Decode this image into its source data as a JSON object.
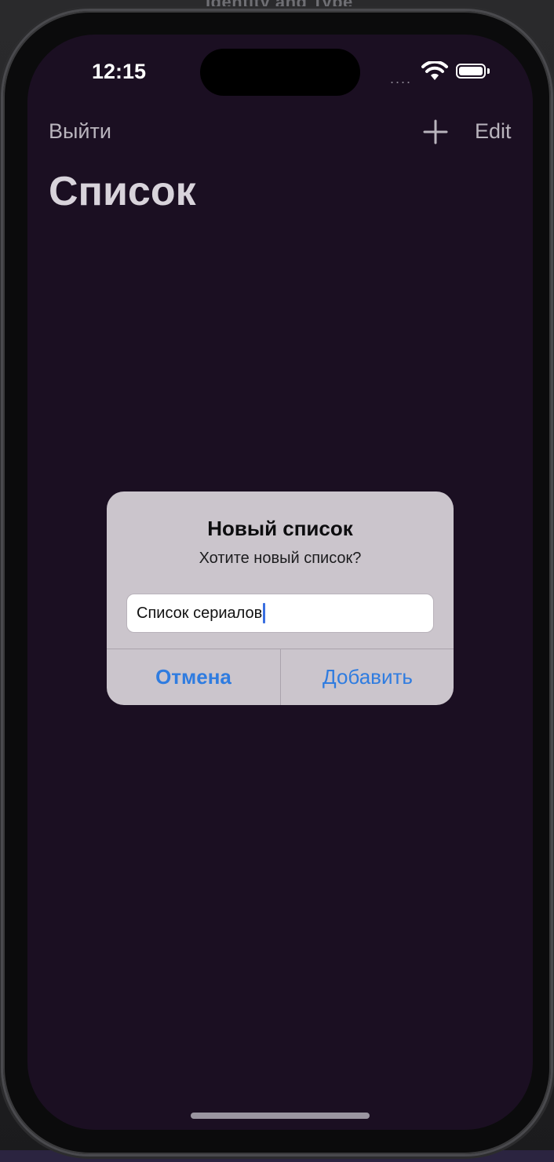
{
  "backdrop": {
    "header_text": "Identity and Type"
  },
  "status_bar": {
    "time": "12:15",
    "signal": "....",
    "wifi_icon": "wifi-icon",
    "battery_icon": "battery-icon"
  },
  "nav": {
    "left_label": "Выйти",
    "plus_icon": "plus-icon",
    "edit_label": "Edit",
    "large_title": "Список"
  },
  "alert": {
    "title": "Новый список",
    "message": "Хотите новый список?",
    "input_value": "Список сериалов",
    "cancel_label": "Отмена",
    "add_label": "Добавить"
  },
  "colors": {
    "screen_background": "#1b0f22",
    "alert_background": "#cbc5cc",
    "accent_blue": "#2f7ce0"
  }
}
